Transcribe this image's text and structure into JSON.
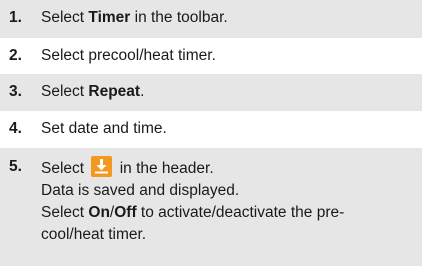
{
  "steps": [
    {
      "number": "1.",
      "before": "Select ",
      "bold": "Timer",
      "after": " in the toolbar."
    },
    {
      "number": "2.",
      "text": "Select precool/heat timer."
    },
    {
      "number": "3.",
      "before": "Select ",
      "bold": "Repeat",
      "after": "."
    },
    {
      "number": "4.",
      "text": "Set date and time."
    },
    {
      "number": "5.",
      "line1_before": "Select ",
      "icon": "save-download-icon",
      "line1_after": " in the header.",
      "line2": "Data is saved and displayed.",
      "line3_before": "Select ",
      "line3_bold_on": "On",
      "line3_slash": "/",
      "line3_bold_off": "Off",
      "line3_after": " to activate/deactivate the pre-",
      "line4": "cool/heat timer."
    }
  ],
  "colors": {
    "shaded_row": "#e6e6e6",
    "icon_orange": "#f39a1e",
    "text": "#1a1a1a"
  }
}
